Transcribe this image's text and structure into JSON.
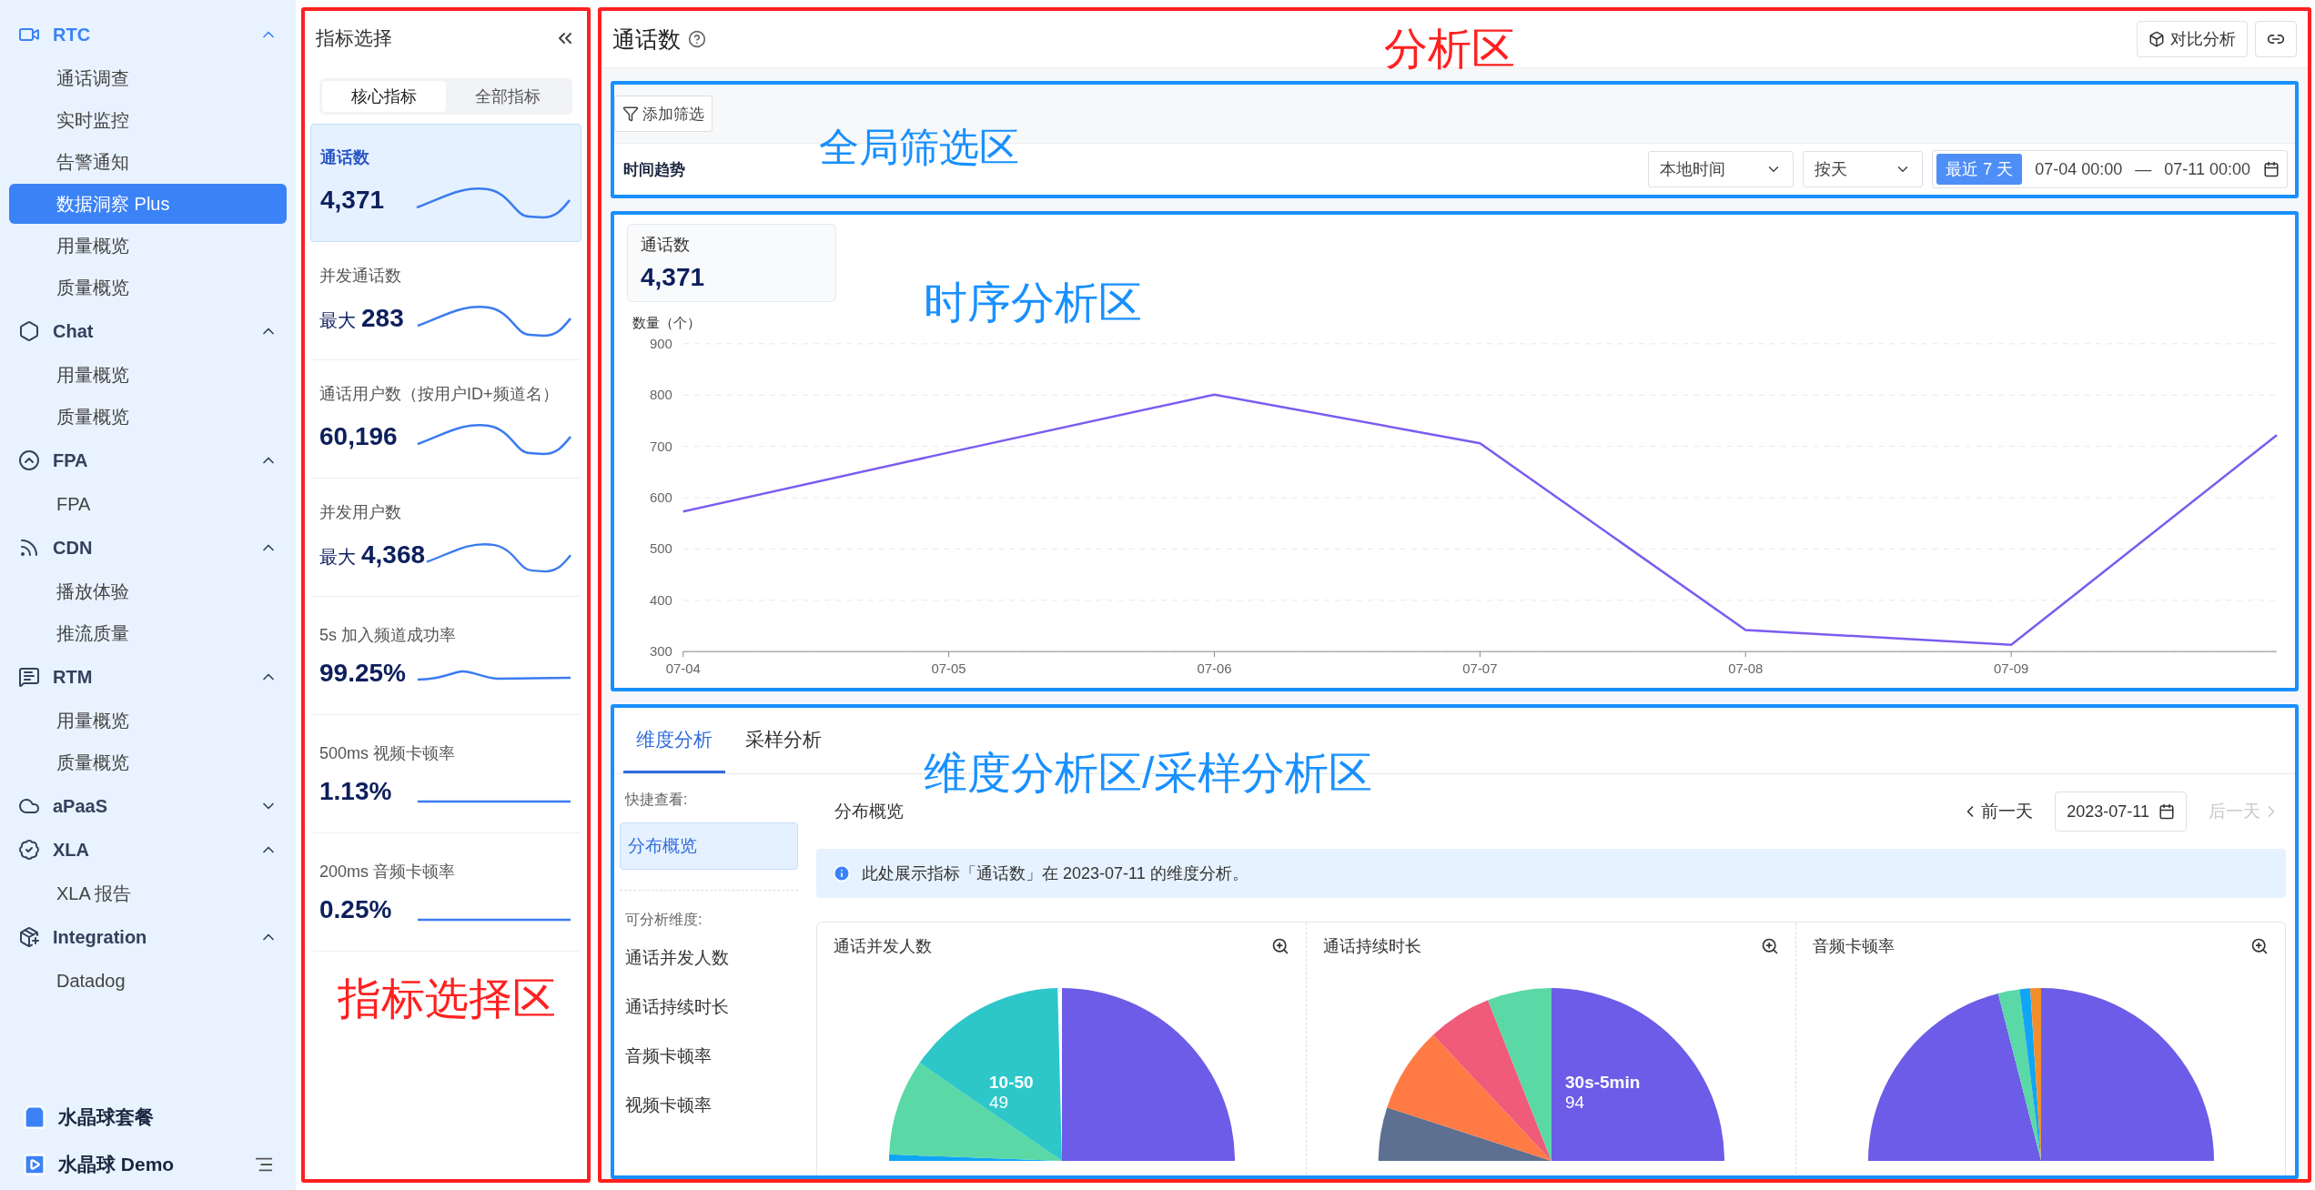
{
  "sidebar": {
    "groups": [
      {
        "label": "RTC",
        "expanded": true,
        "active": true,
        "items": [
          {
            "label": "通话调查",
            "selected": false
          },
          {
            "label": "实时监控",
            "selected": false
          },
          {
            "label": "告警通知",
            "selected": false
          },
          {
            "label": "数据洞察 Plus",
            "selected": true
          },
          {
            "label": "用量概览",
            "selected": false
          },
          {
            "label": "质量概览",
            "selected": false
          }
        ]
      },
      {
        "label": "Chat",
        "expanded": true,
        "active": false,
        "items": [
          {
            "label": "用量概览",
            "selected": false
          },
          {
            "label": "质量概览",
            "selected": false
          }
        ]
      },
      {
        "label": "FPA",
        "expanded": true,
        "active": false,
        "items": [
          {
            "label": "FPA",
            "selected": false
          }
        ]
      },
      {
        "label": "CDN",
        "expanded": true,
        "active": false,
        "items": [
          {
            "label": "播放体验",
            "selected": false
          },
          {
            "label": "推流质量",
            "selected": false
          }
        ]
      },
      {
        "label": "RTM",
        "expanded": true,
        "active": false,
        "items": [
          {
            "label": "用量概览",
            "selected": false
          },
          {
            "label": "质量概览",
            "selected": false
          }
        ]
      },
      {
        "label": "aPaaS",
        "expanded": false,
        "active": false
      },
      {
        "label": "XLA",
        "expanded": true,
        "active": false,
        "items": [
          {
            "label": "XLA 报告",
            "selected": false
          }
        ]
      },
      {
        "label": "Integration",
        "expanded": true,
        "active": false,
        "items": [
          {
            "label": "Datadog",
            "selected": false
          }
        ]
      }
    ],
    "footer": [
      {
        "label": "水晶球套餐"
      },
      {
        "label": "水晶球 Demo"
      }
    ]
  },
  "metric_panel": {
    "title": "指标选择",
    "annotation": {
      "label": "指标选择区",
      "color": "#ff2020"
    },
    "tabs": [
      {
        "label": "核心指标",
        "selected": true
      },
      {
        "label": "全部指标",
        "selected": false
      }
    ],
    "metrics": [
      {
        "name": "通话数",
        "value": "4,371",
        "selected": true,
        "kind": "wave"
      },
      {
        "name": "并发通话数",
        "prefix": "最大",
        "value": "283",
        "selected": false,
        "kind": "wave"
      },
      {
        "name": "通话用户数（按用户ID+频道名）",
        "value": "60,196",
        "selected": false,
        "kind": "wave"
      },
      {
        "name": "并发用户数",
        "prefix": "最大",
        "value": "4,368",
        "selected": false,
        "kind": "wave"
      },
      {
        "name": "5s 加入频道成功率",
        "value": "99.25%",
        "selected": false,
        "kind": "ripple"
      },
      {
        "name": "500ms 视频卡顿率",
        "value": "1.13%",
        "selected": false,
        "kind": "flat"
      },
      {
        "name": "200ms 音频卡顿率",
        "value": "0.25%",
        "selected": false,
        "kind": "flat"
      }
    ]
  },
  "analysis": {
    "title": "通话数",
    "annotation": {
      "label": "分析区",
      "color": "#ff2020"
    },
    "compare_button": "对比分析",
    "filter": {
      "annotation": {
        "label": "全局筛选区",
        "color": "#1890ff"
      },
      "add_filter": "添加筛选",
      "trend_label": "时间趋势",
      "timezone": "本地时间",
      "granularity": "按天",
      "range_tag": "最近 7 天",
      "start": "07-04 00:00",
      "separator": "—",
      "end": "07-11 00:00"
    },
    "timeseries": {
      "annotation": {
        "label": "时序分析区",
        "color": "#1890ff"
      },
      "summary_label": "通话数",
      "summary_value": "4,371",
      "chart_data": {
        "type": "line",
        "ylabel": "数量（个）",
        "x": [
          "07-04",
          "07-05",
          "07-06",
          "07-07",
          "07-08",
          "07-09",
          null
        ],
        "ylim": [
          300,
          900
        ],
        "yticks": [
          300,
          400,
          500,
          600,
          700,
          800,
          900
        ],
        "grid": true,
        "series": [
          {
            "color": "#7b5cf0",
            "values": [
              573,
              688,
              801,
              706,
              342,
              313,
              722
            ]
          }
        ]
      }
    },
    "dimension": {
      "annotation": {
        "label": "维度分析区/采样分析区",
        "color": "#1890ff"
      },
      "tabs": [
        {
          "label": "维度分析",
          "selected": true
        },
        {
          "label": "采样分析",
          "selected": false
        }
      ],
      "quick_label": "快捷查看:",
      "quick_items": [
        {
          "label": "分布概览",
          "selected": true
        }
      ],
      "dims_label": "可分析维度:",
      "dims": [
        "通话并发人数",
        "通话持续时长",
        "音频卡顿率",
        "视频卡顿率"
      ],
      "section_title": "分布概览",
      "prev": "前一天",
      "date": "2023-07-11",
      "next": "后一天",
      "next_disabled": true,
      "info": "此处展示指标「通话数」在 2023-07-11 的维度分析。",
      "pies": [
        {
          "title": "通话并发人数",
          "slice_label": "10-50",
          "slice_value": "49"
        },
        {
          "title": "通话持续时长",
          "slice_label": "30s-5min",
          "slice_value": "94"
        },
        {
          "title": "音频卡顿率"
        }
      ]
    }
  }
}
